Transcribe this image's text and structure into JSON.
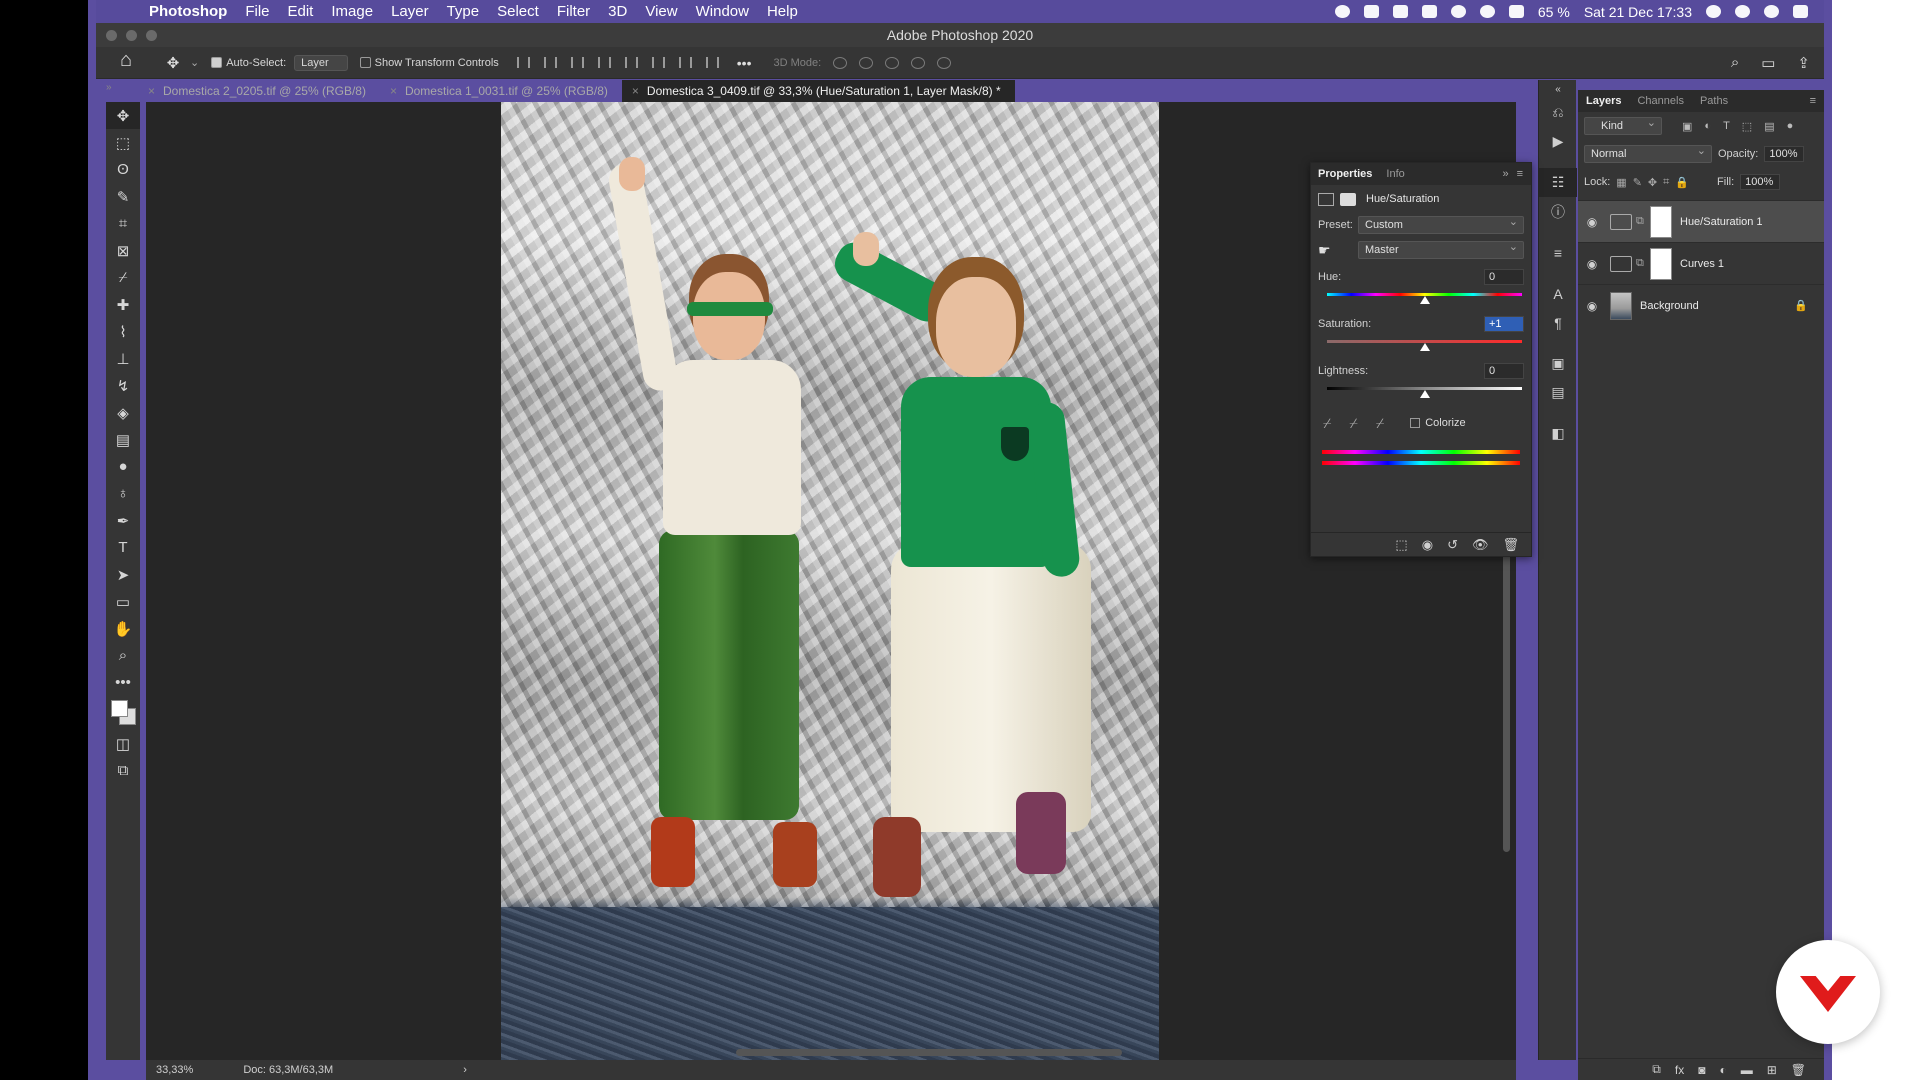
{
  "menubar": {
    "app_name": "Photoshop",
    "items": [
      "File",
      "Edit",
      "Image",
      "Layer",
      "Type",
      "Select",
      "Filter",
      "3D",
      "View",
      "Window",
      "Help"
    ],
    "battery": "65 %",
    "clock": "Sat 21 Dec  17:33"
  },
  "window": {
    "title": "Adobe Photoshop 2020"
  },
  "options_bar": {
    "auto_select_label": "Auto-Select:",
    "auto_select_target": "Layer",
    "transform_label": "Show Transform Controls",
    "mode3d_label": "3D Mode:"
  },
  "tabs": [
    {
      "label": "Domestica 2_0205.tif @ 25% (RGB/8)"
    },
    {
      "label": "Domestica 1_0031.tif @ 25% (RGB/8)"
    },
    {
      "label": "Domestica 3_0409.tif @ 33,3% (Hue/Saturation 1, Layer Mask/8) *"
    }
  ],
  "status": {
    "zoom": "33,33%",
    "doc": "Doc: 63,3M/63,3M"
  },
  "properties": {
    "tabs": [
      "Properties",
      "Info"
    ],
    "adjustment_name": "Hue/Saturation",
    "preset_label": "Preset:",
    "preset_value": "Custom",
    "channel_value": "Master",
    "hue_label": "Hue:",
    "hue_value": "0",
    "saturation_label": "Saturation:",
    "saturation_value": "+1",
    "lightness_label": "Lightness:",
    "lightness_value": "0",
    "colorize_label": "Colorize",
    "hue_level": 0.5,
    "saturation_level": 0.505,
    "lightness_level": 0.5
  },
  "layers_panel": {
    "tabs": [
      "Layers",
      "Channels",
      "Paths"
    ],
    "filter_kind": "Kind",
    "blend_mode": "Normal",
    "opacity_label": "Opacity:",
    "opacity_value": "100%",
    "lock_label": "Lock:",
    "fill_label": "Fill:",
    "fill_value": "100%",
    "layers": [
      {
        "name": "Hue/Saturation 1",
        "selected": true
      },
      {
        "name": "Curves 1",
        "selected": false
      },
      {
        "name": "Background",
        "selected": false
      }
    ]
  },
  "colors": {
    "desktop_purple": "#5b4ea0",
    "panel_bg": "#353535",
    "canvas_bg": "#262626",
    "highlight_blue": "#2f5fb5",
    "brand_red": "#e01b1b"
  }
}
